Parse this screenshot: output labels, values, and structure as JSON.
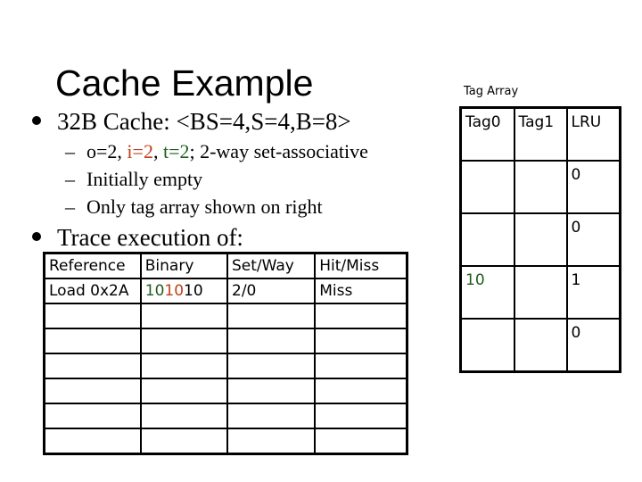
{
  "slide": {
    "title": "Cache Example",
    "bullets": [
      {
        "text": "32B Cache: <BS=4,S=4,B=8>"
      },
      {
        "text": "Trace execution of:"
      }
    ],
    "sub_bullets": [
      {
        "dash": "–",
        "parts": [
          {
            "text": "o=2, ",
            "color": "default"
          },
          {
            "text": "i=2",
            "color": "red"
          },
          {
            "text": ", ",
            "color": "default"
          },
          {
            "text": "t=2",
            "color": "green"
          },
          {
            "text": "; 2-way set-associative",
            "color": "default"
          }
        ]
      },
      {
        "dash": "–",
        "text": "Initially empty"
      },
      {
        "dash": "–",
        "text": "Only tag array shown on right"
      }
    ]
  },
  "colors": {
    "red": "#c0401a",
    "green": "#1e5e1e"
  },
  "trace_table": {
    "headers": [
      "Reference",
      "Binary",
      "Set/Way",
      "Hit/Miss"
    ],
    "rows": [
      {
        "reference": "Load 0x2A",
        "binary": {
          "tag": "10",
          "index": "10",
          "offset": "10"
        },
        "set_way": "2/0",
        "hit_miss": "Miss"
      },
      {
        "reference": "",
        "binary": {
          "tag": "",
          "index": "",
          "offset": ""
        },
        "set_way": "",
        "hit_miss": ""
      },
      {
        "reference": "",
        "binary": {
          "tag": "",
          "index": "",
          "offset": ""
        },
        "set_way": "",
        "hit_miss": ""
      },
      {
        "reference": "",
        "binary": {
          "tag": "",
          "index": "",
          "offset": ""
        },
        "set_way": "",
        "hit_miss": ""
      },
      {
        "reference": "",
        "binary": {
          "tag": "",
          "index": "",
          "offset": ""
        },
        "set_way": "",
        "hit_miss": ""
      },
      {
        "reference": "",
        "binary": {
          "tag": "",
          "index": "",
          "offset": ""
        },
        "set_way": "",
        "hit_miss": ""
      },
      {
        "reference": "",
        "binary": {
          "tag": "",
          "index": "",
          "offset": ""
        },
        "set_way": "",
        "hit_miss": ""
      }
    ]
  },
  "tag_array": {
    "label": "Tag Array",
    "headers": [
      "Tag0",
      "Tag1",
      "LRU"
    ],
    "rows": [
      {
        "tag0": "",
        "tag1": "",
        "lru": "0"
      },
      {
        "tag0": "",
        "tag1": "",
        "lru": "0"
      },
      {
        "tag0": "10",
        "tag1": "",
        "lru": "1"
      },
      {
        "tag0": "",
        "tag1": "",
        "lru": "0"
      }
    ]
  }
}
